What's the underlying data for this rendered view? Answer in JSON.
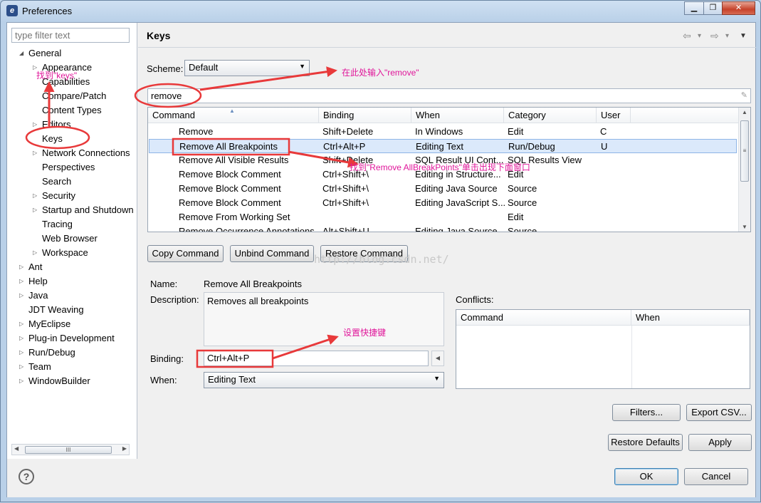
{
  "window": {
    "title": "Preferences",
    "icon": "eclipse-icon",
    "controls": [
      "▁",
      "❐",
      "✕"
    ]
  },
  "left": {
    "filter_placeholder": "type filter text",
    "tree": [
      {
        "label": "General",
        "indent": 0,
        "twisty": "◢"
      },
      {
        "label": "Appearance",
        "indent": 1,
        "twisty": "▷"
      },
      {
        "label": "Capabilities",
        "indent": 1,
        "twisty": ""
      },
      {
        "label": "Compare/Patch",
        "indent": 1,
        "twisty": ""
      },
      {
        "label": "Content Types",
        "indent": 1,
        "twisty": ""
      },
      {
        "label": "Editors",
        "indent": 1,
        "twisty": "▷"
      },
      {
        "label": "Keys",
        "indent": 1,
        "twisty": ""
      },
      {
        "label": "Network Connections",
        "indent": 1,
        "twisty": "▷"
      },
      {
        "label": "Perspectives",
        "indent": 1,
        "twisty": ""
      },
      {
        "label": "Search",
        "indent": 1,
        "twisty": ""
      },
      {
        "label": "Security",
        "indent": 1,
        "twisty": "▷"
      },
      {
        "label": "Startup and Shutdown",
        "indent": 1,
        "twisty": "▷"
      },
      {
        "label": "Tracing",
        "indent": 1,
        "twisty": ""
      },
      {
        "label": "Web Browser",
        "indent": 1,
        "twisty": ""
      },
      {
        "label": "Workspace",
        "indent": 1,
        "twisty": "▷"
      },
      {
        "label": "Ant",
        "indent": 0,
        "twisty": "▷"
      },
      {
        "label": "Help",
        "indent": 0,
        "twisty": "▷"
      },
      {
        "label": "Java",
        "indent": 0,
        "twisty": "▷"
      },
      {
        "label": "JDT Weaving",
        "indent": 0,
        "twisty": ""
      },
      {
        "label": "MyEclipse",
        "indent": 0,
        "twisty": "▷"
      },
      {
        "label": "Plug-in Development",
        "indent": 0,
        "twisty": "▷"
      },
      {
        "label": "Run/Debug",
        "indent": 0,
        "twisty": "▷"
      },
      {
        "label": "Team",
        "indent": 0,
        "twisty": "▷"
      },
      {
        "label": "WindowBuilder",
        "indent": 0,
        "twisty": "▷"
      }
    ],
    "hscroll_thumb": "III"
  },
  "keys": {
    "title": "Keys",
    "nav": [
      "⇦",
      "▾",
      "⇨",
      "▾",
      "▼"
    ],
    "scheme_label": "Scheme:",
    "scheme_value": "Default",
    "filter_value": "remove",
    "columns": [
      "Command",
      "Binding",
      "When",
      "Category",
      "User"
    ],
    "rows": [
      [
        "Remove",
        "Shift+Delete",
        "In Windows",
        "Edit",
        "C"
      ],
      [
        "Remove All Breakpoints",
        "Ctrl+Alt+P",
        "Editing Text",
        "Run/Debug",
        "U"
      ],
      [
        "Remove All Visible Results",
        "Shift+Delete",
        "SQL Result UI Cont...",
        "SQL Results View",
        ""
      ],
      [
        "Remove Block Comment",
        "Ctrl+Shift+\\",
        "Editing in Structure...",
        "Edit",
        ""
      ],
      [
        "Remove Block Comment",
        "Ctrl+Shift+\\",
        "Editing Java Source",
        "Source",
        ""
      ],
      [
        "Remove Block Comment",
        "Ctrl+Shift+\\",
        "Editing JavaScript S...",
        "Source",
        ""
      ],
      [
        "Remove From Working Set",
        "",
        "",
        "Edit",
        ""
      ],
      [
        "Remove Occurrence Annotations",
        "Alt+Shift+U",
        "Editing Java Source",
        "Source",
        ""
      ]
    ],
    "buttons": {
      "copy": "Copy Command",
      "unbind": "Unbind Command",
      "restore": "Restore Command"
    },
    "name_label": "Name:",
    "name_value": "Remove All Breakpoints",
    "description_label": "Description:",
    "description_value": "Removes all breakpoints",
    "binding_label": "Binding:",
    "binding_value": "Ctrl+Alt+P",
    "when_label": "When:",
    "when_value": "Editing Text",
    "conflicts_label": "Conflicts:",
    "conflicts_columns": [
      "Command",
      "When"
    ],
    "filters_button": "Filters...",
    "export_button": "Export CSV...",
    "restore_defaults_button": "Restore Defaults",
    "apply_button": "Apply"
  },
  "bottom": {
    "help": "?",
    "ok": "OK",
    "cancel": "Cancel"
  },
  "annotations": {
    "find_keys": "找到\"keys\"",
    "type_here": "在此处输入\"remove\"",
    "find_remove": "找到\"Remove AllBreakPoints\"单击出现下面窗口",
    "set_shortcut": "设置快捷键",
    "color": "#e0169a",
    "watermark": "http://blog.csdn.net/"
  }
}
